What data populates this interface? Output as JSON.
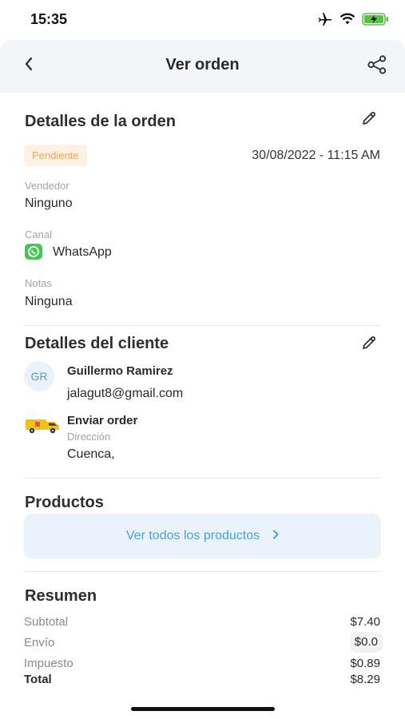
{
  "status_bar": {
    "time": "15:35"
  },
  "nav": {
    "title": "Ver orden"
  },
  "order_details": {
    "title": "Detalles de la orden",
    "status": "Pendiente",
    "datetime": "30/08/2022 - 11:15 AM",
    "vendor_label": "Vendedor",
    "vendor_value": "Ninguno",
    "channel_label": "Canal",
    "channel_value": "WhatsApp",
    "notes_label": "Notas",
    "notes_value": "Ninguna"
  },
  "client_details": {
    "title": "Detalles del cliente",
    "initials": "GR",
    "name": "Guillermo Ramirez",
    "email": "jalagut8@gmail.com",
    "shipping_title": "Enviar order",
    "address_label": "Dirección",
    "address_value": "Cuenca,"
  },
  "products": {
    "title": "Productos",
    "view_all_label": "Ver todos los productos"
  },
  "summary": {
    "title": "Resumen",
    "subtotal_label": "Subtotal",
    "subtotal_value": "$7.40",
    "shipping_label": "Envío",
    "shipping_value": "$0.0",
    "tax_label": "Impuesto",
    "tax_value": "$0.89",
    "total_label": "Total",
    "total_value": "$8.29"
  },
  "colors": {
    "accent": "#4aa0d8",
    "badge_bg": "#fdf1e4",
    "badge_text": "#f0a65a",
    "whatsapp": "#4cc45a"
  }
}
